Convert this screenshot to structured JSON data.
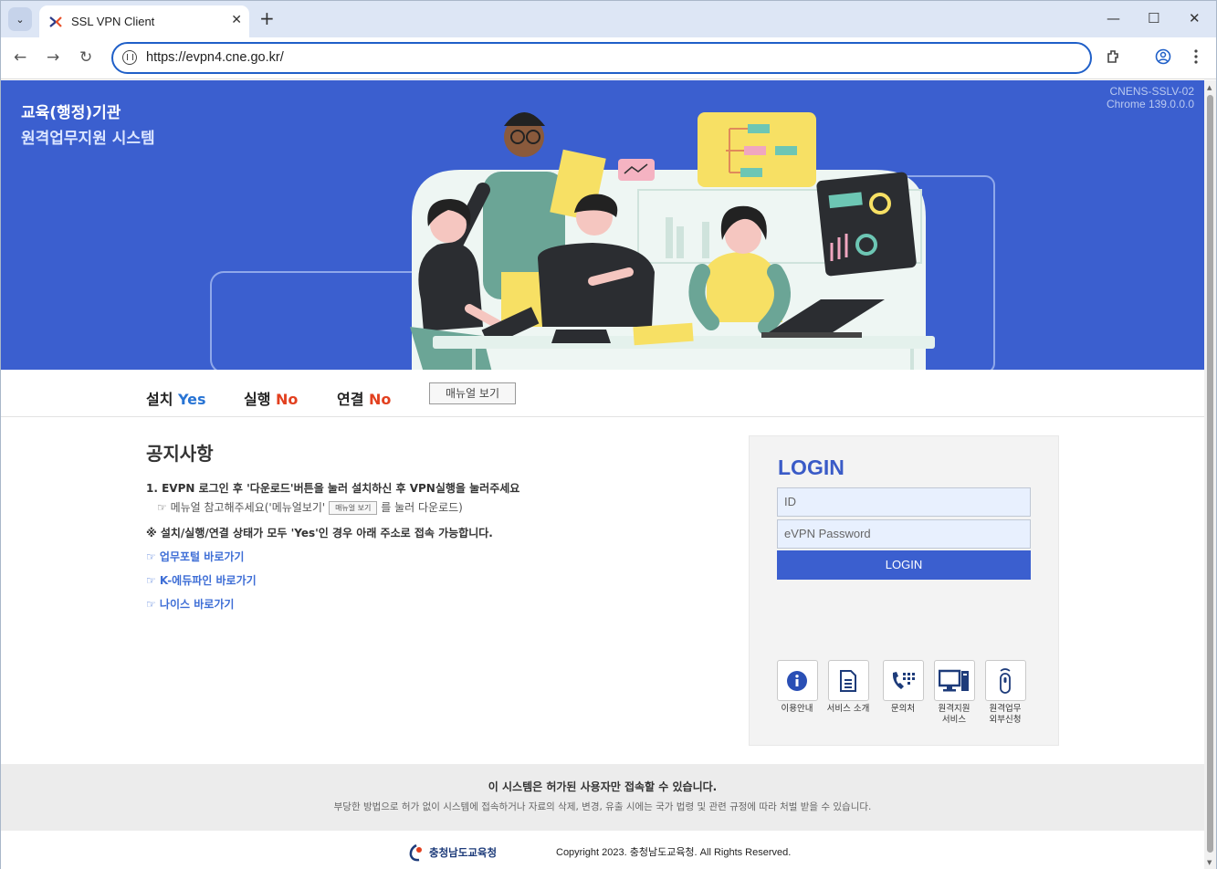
{
  "browser": {
    "tab_title": "SSL VPN Client",
    "tab_close": "✕",
    "new_tab": "+",
    "url": "https://evpn4.cne.go.kr/",
    "minimize": "—",
    "maximize": "☐",
    "close": "✕"
  },
  "hero": {
    "title_line1": "교육(행정)기관",
    "title_line2": "원격업무지원 시스템",
    "version_line1": "CNENS-SSLV-02",
    "version_line2": "Chrome 139.0.0.0"
  },
  "status": {
    "install_label": "설치",
    "install_value": "Yes",
    "run_label": "실행",
    "run_value": "No",
    "connect_label": "연결",
    "connect_value": "No",
    "manual_button": "매뉴얼 보기"
  },
  "notice": {
    "title": "공지사항",
    "line1": "1. EVPN 로그인 후 '다운로드'버튼을 눌러 설치하신 후 VPN실행을 눌러주세요",
    "line2_prefix": "☞ 메뉴얼 참고해주세요('메뉴얼보기'",
    "line2_button": "매뉴얼 보기",
    "line2_suffix": "를 눌러 다운로드)",
    "line3": "※ 설치/실행/연결 상태가 모두 'Yes'인 경우 아래 주소로 접속 가능합니다.",
    "links": [
      "☞ 업무포털 바로가기",
      "☞ K-에듀파인 바로가기",
      "☞ 나이스 바로가기"
    ]
  },
  "login": {
    "title": "LOGIN",
    "id_placeholder": "ID",
    "password_placeholder": "eVPN Password",
    "button": "LOGIN"
  },
  "services": [
    {
      "label": "이용안내",
      "icon": "info-icon"
    },
    {
      "label": "서비스 소개",
      "icon": "document-icon"
    },
    {
      "label": "문의처",
      "icon": "phone-icon"
    },
    {
      "label1": "원격지원",
      "label2": "서비스",
      "icon": "computer-icon"
    },
    {
      "label1": "원격업무",
      "label2": "외부신청",
      "icon": "remote-icon"
    }
  ],
  "footer": {
    "warning_title": "이 시스템은 허가된 사용자만 접속할 수 있습니다.",
    "warning_body": "부당한 방법으로 허가 없이 시스템에 접속하거나 자료의 삭제, 변경, 유출 시에는 국가 법령 및 관련 규정에 따라 처벌 받을 수 있습니다.",
    "org_name": "충청남도교육청",
    "copyright": "Copyright 2023. 충청남도교육청. All Rights Reserved."
  },
  "colors": {
    "brand_blue": "#3b5fcf",
    "yes_blue": "#2874d4",
    "no_red": "#e2401f",
    "link_blue": "#3e6ed6"
  }
}
